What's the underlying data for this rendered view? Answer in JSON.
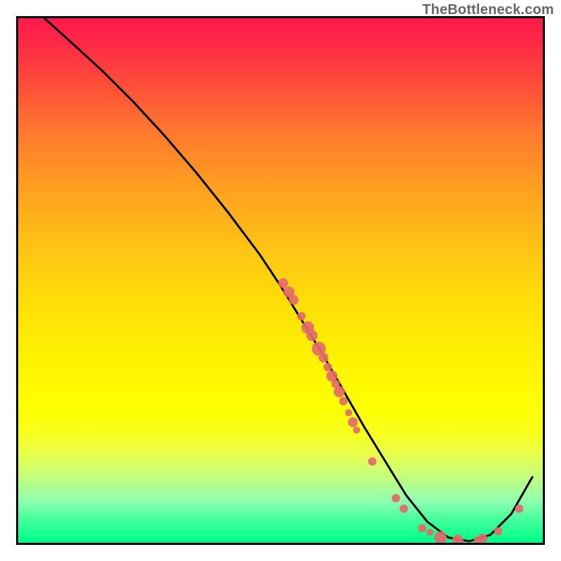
{
  "watermark": "TheBottleneck.com",
  "chart_data": {
    "type": "line",
    "title": "",
    "xlabel": "",
    "ylabel": "",
    "xlim": [
      0,
      100
    ],
    "ylim": [
      0,
      100
    ],
    "curve": {
      "name": "curve",
      "x": [
        5,
        10,
        16,
        22,
        28,
        34,
        40,
        46,
        50,
        54,
        58,
        62,
        66,
        70,
        74,
        78,
        82,
        86,
        90,
        94,
        98
      ],
      "y": [
        100,
        95.5,
        90,
        84,
        77.5,
        70.5,
        63,
        55,
        49,
        42.5,
        36,
        29,
        22,
        15.5,
        9,
        4,
        1,
        0.3,
        1.5,
        5.5,
        12.5
      ]
    },
    "points": {
      "name": "scatter",
      "color": "#e46a6a",
      "data": [
        {
          "x": 50.5,
          "y": 49.5,
          "r": 7
        },
        {
          "x": 51.6,
          "y": 47.8,
          "r": 8
        },
        {
          "x": 52.5,
          "y": 46.3,
          "r": 7
        },
        {
          "x": 54.0,
          "y": 43.2,
          "r": 6
        },
        {
          "x": 55.2,
          "y": 41.0,
          "r": 9
        },
        {
          "x": 56.0,
          "y": 39.5,
          "r": 8
        },
        {
          "x": 57.3,
          "y": 37.0,
          "r": 10
        },
        {
          "x": 58.2,
          "y": 35.3,
          "r": 7
        },
        {
          "x": 59.0,
          "y": 33.5,
          "r": 6
        },
        {
          "x": 59.8,
          "y": 31.8,
          "r": 8
        },
        {
          "x": 60.5,
          "y": 30.3,
          "r": 6
        },
        {
          "x": 61.2,
          "y": 28.8,
          "r": 8
        },
        {
          "x": 62.0,
          "y": 27.0,
          "r": 6
        },
        {
          "x": 63.0,
          "y": 24.8,
          "r": 5
        },
        {
          "x": 63.8,
          "y": 23.0,
          "r": 7
        },
        {
          "x": 64.5,
          "y": 21.5,
          "r": 5
        },
        {
          "x": 67.5,
          "y": 15.5,
          "r": 6
        },
        {
          "x": 72.0,
          "y": 8.5,
          "r": 6
        },
        {
          "x": 73.5,
          "y": 6.5,
          "r": 6
        },
        {
          "x": 77.0,
          "y": 2.8,
          "r": 6
        },
        {
          "x": 78.5,
          "y": 2.0,
          "r": 5
        },
        {
          "x": 80.5,
          "y": 1.0,
          "r": 9
        },
        {
          "x": 83.8,
          "y": 0.5,
          "r": 8
        },
        {
          "x": 87.5,
          "y": 0.5,
          "r": 5
        },
        {
          "x": 88.5,
          "y": 0.8,
          "r": 7
        },
        {
          "x": 91.5,
          "y": 2.2,
          "r": 6
        },
        {
          "x": 95.5,
          "y": 6.5,
          "r": 6
        }
      ]
    }
  }
}
